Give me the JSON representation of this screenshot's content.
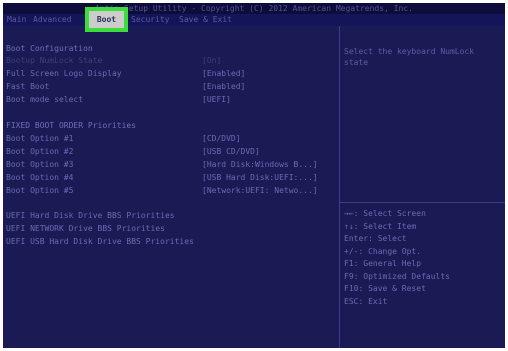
{
  "title_bar": "Aptio Setup Utility - Copyright (C) 2012 American Megatrends, Inc.",
  "tabs": [
    "Main",
    "Advanced",
    "Boot",
    "Security",
    "Save & Exit"
  ],
  "active_tab": "Boot",
  "accent_color": "#3bdc3b",
  "boot_configuration": {
    "header": "Boot Configuration",
    "items": [
      {
        "label": "Bootup NumLock State",
        "value": "[On]"
      },
      {
        "label": "Full Screen Logo Display",
        "value": "[Enabled]"
      },
      {
        "label": "Fast Boot",
        "value": "[Enabled]"
      },
      {
        "label": "Boot mode select",
        "value": "[UEFI]"
      }
    ]
  },
  "fixed_boot_order": {
    "header": "FIXED BOOT ORDER Priorities",
    "items": [
      {
        "label": "Boot Option #1",
        "value": "[CD/DVD]"
      },
      {
        "label": "Boot Option #2",
        "value": "[USB CD/DVD]"
      },
      {
        "label": "Boot Option #3",
        "value": "[Hard Disk:Windows B...]"
      },
      {
        "label": "Boot Option #4",
        "value": "[USB Hard Disk:UEFI:...]"
      },
      {
        "label": "Boot Option #5",
        "value": "[Network:UEFI: Netwo...]"
      }
    ]
  },
  "bbs_priorities": [
    "UEFI Hard Disk Drive BBS Priorities",
    "UEFI NETWORK Drive BBS Priorities",
    "UEFI USB Hard Disk Drive BBS Priorities"
  ],
  "help_text": "Select the keyboard NumLock state",
  "key_legend": [
    "→←: Select Screen",
    "↑↓: Select Item",
    "Enter: Select",
    "+/-: Change Opt.",
    "F1: General Help",
    "F9: Optimized Defaults",
    "F10: Save & Reset",
    "ESC: Exit"
  ]
}
